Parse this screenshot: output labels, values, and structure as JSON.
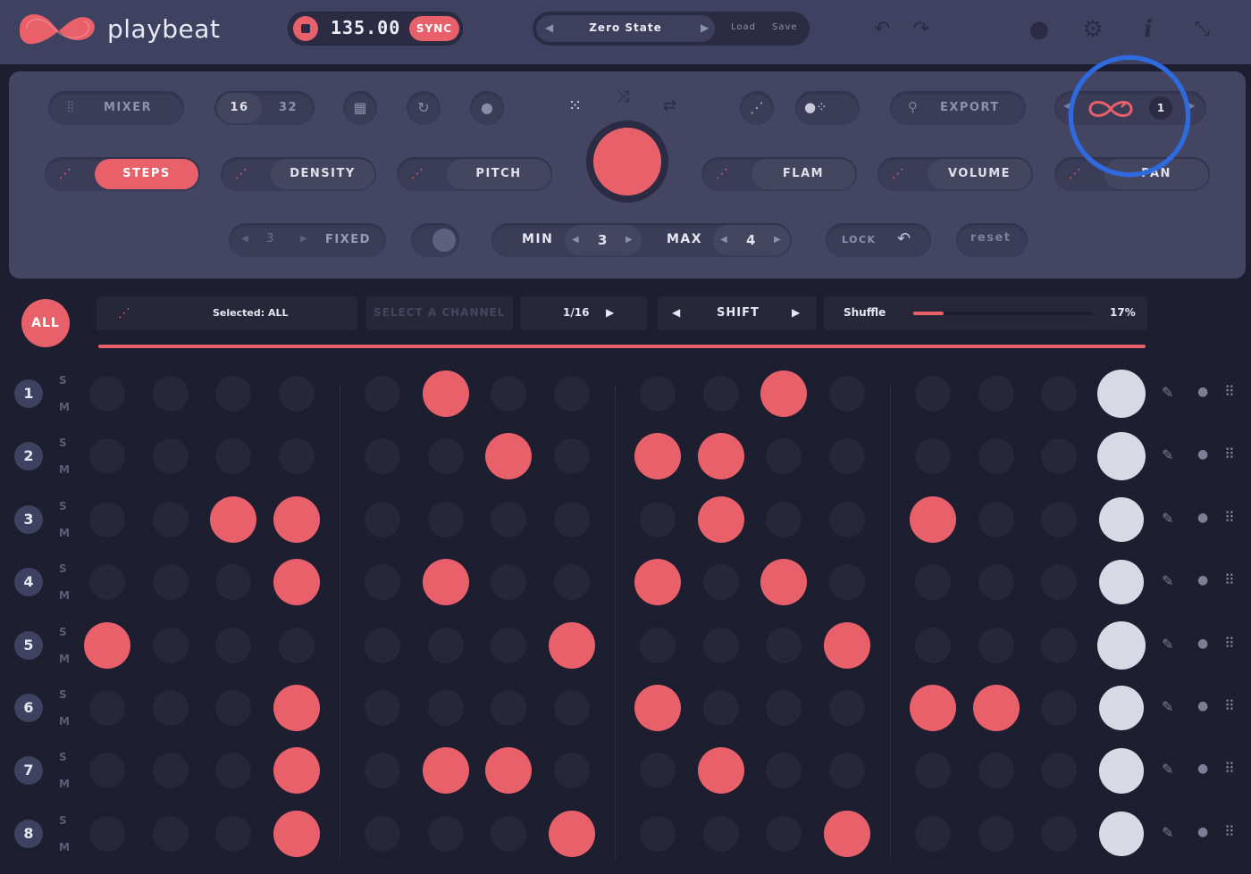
{
  "app": {
    "brand": "playbeat"
  },
  "transport": {
    "bpm": "135.00",
    "sync_label": "SYNC"
  },
  "preset": {
    "name": "Zero State",
    "load_label": "Load",
    "save_label": "Save"
  },
  "controls": {
    "mixer_label": "MIXER",
    "steps_16": "16",
    "steps_32": "32",
    "export_label": "EXPORT",
    "loop_count": "1",
    "params": [
      "STEPS",
      "DENSITY",
      "PITCH",
      "FLAM",
      "VOLUME",
      "PAN"
    ],
    "fixed_value": "3",
    "fixed_label": "FIXED",
    "min_label": "MIN",
    "min_value": "3",
    "max_label": "MAX",
    "max_value": "4",
    "lock_label": "LOCK",
    "reset_label": "reset"
  },
  "toolbar": {
    "all_label": "ALL",
    "selected_text": "Selected: ALL",
    "select_channel": "SELECT A CHANNEL",
    "division": "1/16",
    "shift_label": "SHIFT",
    "shuffle_label": "Shuffle",
    "shuffle_value": "17%",
    "shuffle_fraction": 0.17
  },
  "grid": {
    "solo_label": "S",
    "mute_label": "M",
    "rows": [
      {
        "num": "1",
        "steps": [
          0,
          0,
          0,
          0,
          0,
          1,
          0,
          0,
          0,
          0,
          1,
          0,
          0,
          0,
          0
        ],
        "vol": 1.0
      },
      {
        "num": "2",
        "steps": [
          0,
          0,
          0,
          0,
          0,
          0,
          1,
          0,
          1,
          1,
          0,
          0,
          0,
          0,
          0
        ],
        "vol": 1.0
      },
      {
        "num": "3",
        "steps": [
          0,
          0,
          1,
          1,
          0,
          0,
          0,
          0,
          0,
          1,
          0,
          0,
          1,
          0,
          0
        ],
        "vol": 0.75
      },
      {
        "num": "4",
        "steps": [
          0,
          0,
          0,
          1,
          0,
          1,
          0,
          0,
          1,
          0,
          1,
          0,
          0,
          0,
          0
        ],
        "vol": 0.75
      },
      {
        "num": "5",
        "steps": [
          1,
          0,
          0,
          0,
          0,
          0,
          0,
          1,
          0,
          0,
          0,
          1,
          0,
          0,
          0
        ],
        "vol": 1.0
      },
      {
        "num": "6",
        "steps": [
          0,
          0,
          0,
          1,
          0,
          0,
          0,
          0,
          1,
          0,
          0,
          0,
          1,
          1,
          0
        ],
        "vol": 0.75
      },
      {
        "num": "7",
        "steps": [
          0,
          0,
          0,
          1,
          0,
          1,
          1,
          0,
          0,
          1,
          0,
          0,
          0,
          0,
          0
        ],
        "vol": 0.75
      },
      {
        "num": "8",
        "steps": [
          0,
          0,
          0,
          1,
          0,
          0,
          0,
          1,
          0,
          0,
          0,
          1,
          0,
          0,
          0
        ],
        "vol": 0.75
      }
    ]
  },
  "colors": {
    "accent": "#e8606a",
    "bg": "#1d1e2f",
    "panel": "#434563",
    "highlight": "#2f6be0"
  }
}
